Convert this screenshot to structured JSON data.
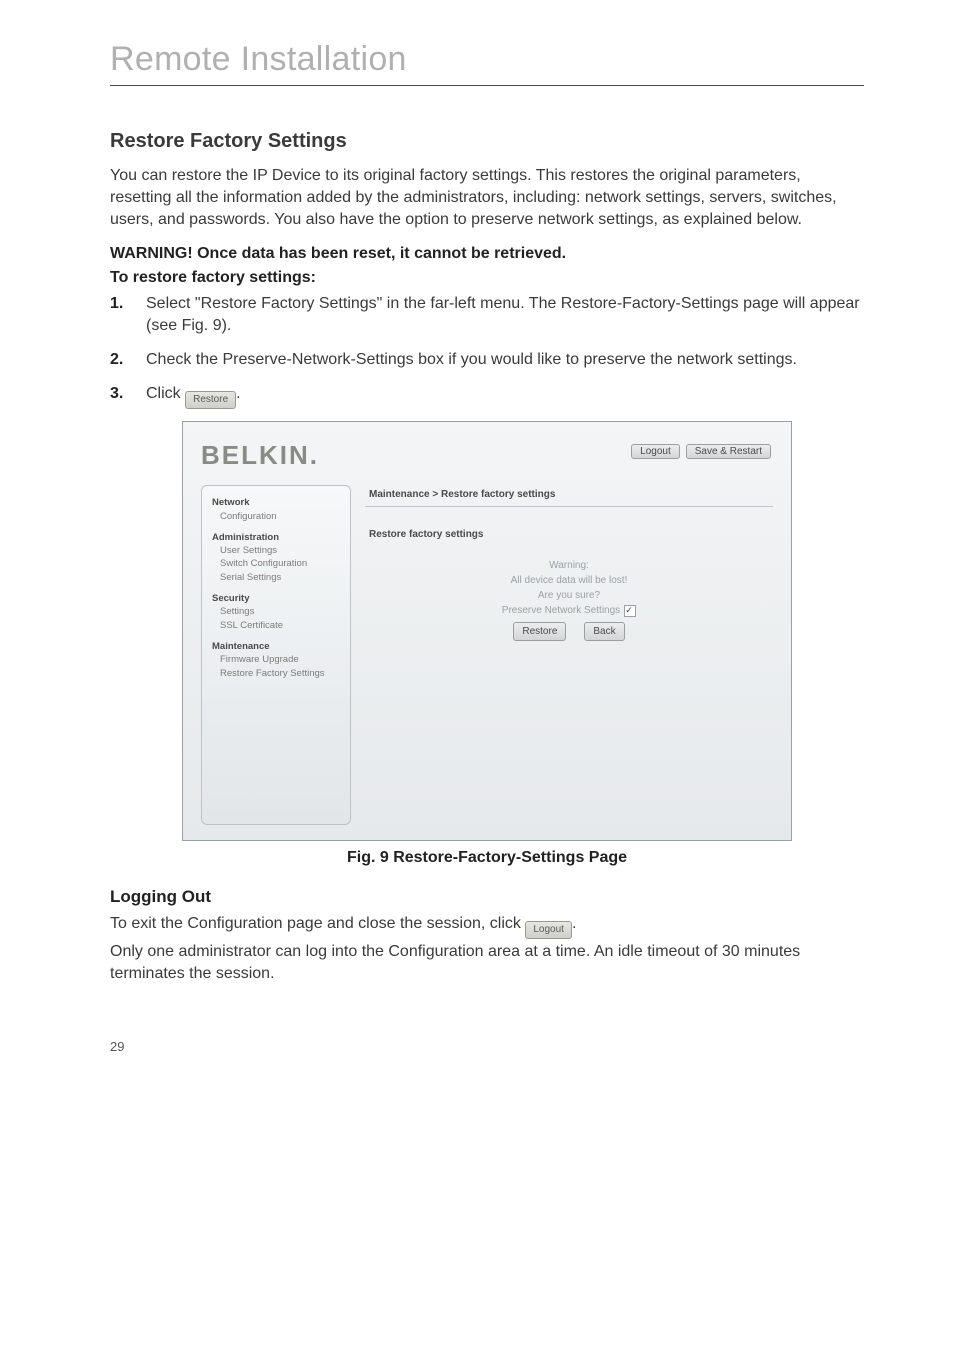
{
  "page": {
    "chapter_title": "Remote Installation",
    "page_number": "29"
  },
  "section": {
    "title": "Restore Factory Settings",
    "intro": "You can restore the IP Device to its original factory settings. This restores the original parameters, resetting all the information added by the administrators, including: network settings, servers, switches, users, and passwords. You also have the option to preserve network settings, as explained below.",
    "warning": "WARNING! Once data has been reset, it cannot be retrieved.",
    "howto_label": "To restore factory settings:",
    "steps": {
      "n1": "1.",
      "t1": "Select \"Restore Factory Settings\" in the far-left menu. The Restore-Factory-Settings page will appear (see Fig. 9).",
      "n2": "2.",
      "t2": "Check the Preserve-Network-Settings box if you would like to preserve the network settings.",
      "n3": "3.",
      "t3_prefix": "Click ",
      "t3_btn": "Restore",
      "t3_suffix": "."
    }
  },
  "figure": {
    "brand": "BELKIN.",
    "logout_btn": "Logout",
    "save_btn": "Save & Restart",
    "sidebar": {
      "network_h": "Network",
      "network_config": "Configuration",
      "admin_h": "Administration",
      "admin_user": "User Settings",
      "admin_switch": "Switch Configuration",
      "admin_serial": "Serial Settings",
      "security_h": "Security",
      "security_settings": "Settings",
      "security_ssl": "SSL Certificate",
      "maint_h": "Maintenance",
      "maint_fw": "Firmware Upgrade",
      "maint_restore": "Restore Factory Settings"
    },
    "main": {
      "breadcrumb": "Maintenance > Restore factory settings",
      "subtitle": "Restore factory settings",
      "warning_label": "Warning:",
      "warn_line1": "All device data will be lost!",
      "warn_line2": "Are you sure?",
      "preserve_label": "Preserve Network Settings",
      "restore_btn": "Restore",
      "back_btn": "Back"
    },
    "caption": "Fig. 9 Restore-Factory-Settings Page"
  },
  "logging": {
    "title": "Logging Out",
    "p_prefix": "To exit the Configuration page and close the session, click ",
    "p_btn": "Logout",
    "p_suffix": ".",
    "p2": "Only one administrator can log into the Configuration area at a time. An idle timeout of 30 minutes terminates the session."
  }
}
